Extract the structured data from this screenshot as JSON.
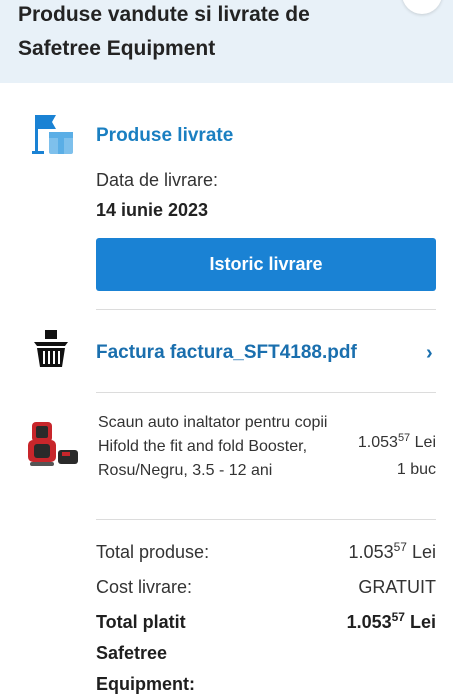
{
  "header": {
    "title": "Produse vandute si livrate de Safetree Equipment",
    "close_icon": "close-icon"
  },
  "delivery": {
    "title": "Produse livrate",
    "date_label": "Data de livrare:",
    "date_value": "14 iunie 2023",
    "history_button": "Istoric livrare",
    "icon": "flag-box-icon"
  },
  "invoice": {
    "label": "Factura factura_SFT4188.pdf",
    "chevron": "›",
    "icon": "basket-icon"
  },
  "product": {
    "name": "Scaun auto inaltator pentru copii Hifold the fit and fold Booster, Rosu/Negru, 3.5 - 12 ani",
    "price_int": "1.053",
    "price_dec": "57",
    "currency": "Lei",
    "quantity": "1 buc",
    "thumb_icon": "car-seat-image"
  },
  "summary": {
    "total_products_label": "Total produse:",
    "total_products_int": "1.053",
    "total_products_dec": "57",
    "total_products_currency": "Lei",
    "shipping_label": "Cost livrare:",
    "shipping_value": "GRATUIT",
    "total_paid_label_line1": "Total platit",
    "total_paid_label_line2": "Safetree",
    "total_paid_label_line3": "Equipment:",
    "total_paid_int": "1.053",
    "total_paid_dec": "57",
    "total_paid_currency": "Lei"
  },
  "colors": {
    "accent": "#1a82d4",
    "link": "#1a6fae",
    "header_bg": "#e8f1f8"
  }
}
